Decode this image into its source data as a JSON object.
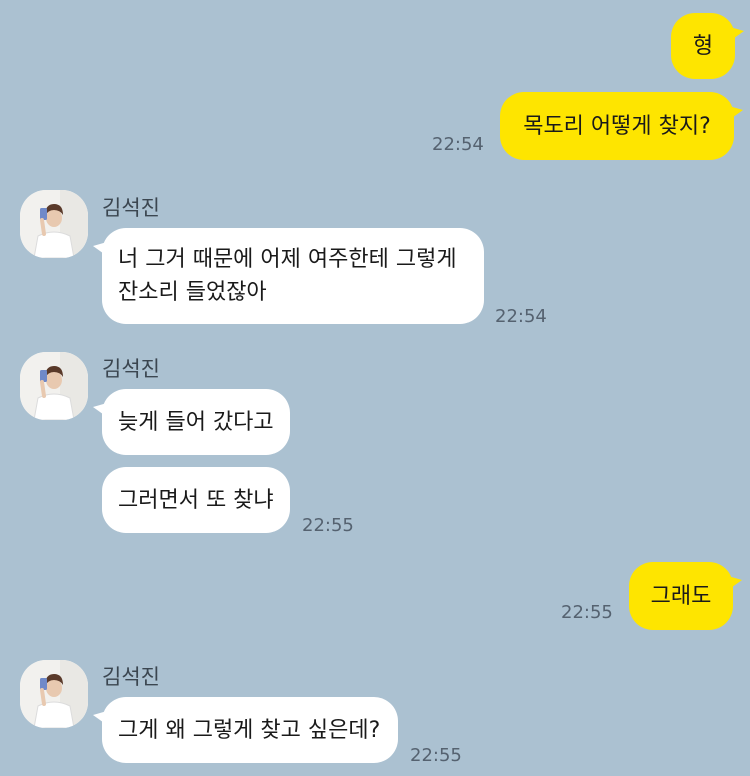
{
  "contact": {
    "name": "김석진"
  },
  "messages": [
    {
      "sender": "me",
      "text": "형"
    },
    {
      "sender": "me",
      "text": "목도리 어떻게 찾지?",
      "time": "22:54"
    },
    {
      "sender": "other",
      "text_line1": "너 그거 때문에 어제 여주한테 그렇게",
      "text_line2": "잔소리 들었잖아",
      "time": "22:54"
    },
    {
      "sender": "other",
      "text": "늦게 들어 갔다고"
    },
    {
      "sender": "other",
      "text": "그러면서 또 찾냐",
      "time": "22:55"
    },
    {
      "sender": "me",
      "text": "그래도",
      "time": "22:55"
    },
    {
      "sender": "other",
      "text": "그게 왜 그렇게 찾고 싶은데?",
      "time": "22:55"
    }
  ],
  "colors": {
    "background": "#abc1d1",
    "my_bubble": "#fee500",
    "their_bubble": "#ffffff"
  }
}
